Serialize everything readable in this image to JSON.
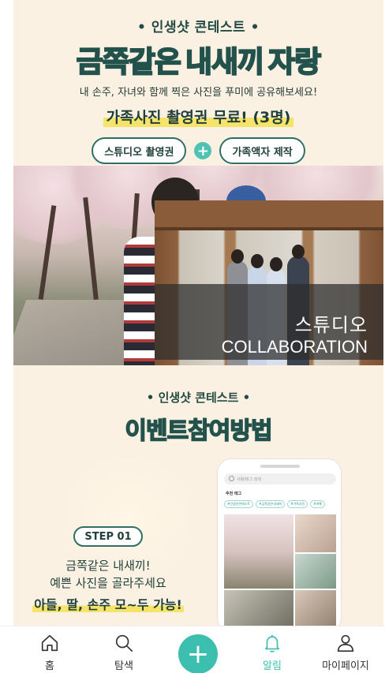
{
  "banner": {
    "pill_title": "• 인생샷 콘테스트 •",
    "title_part1": "금쪽같은",
    "title_part2": "내새끼",
    "title_part3": "자랑",
    "subtitle": "내 손주, 자녀와 함께 찍은 사진을 푸미에 공유해보세요!",
    "highlight": "가족사진 촬영권 무료! (3명)",
    "chip_left": "스튜디오 촬영권",
    "chip_plus": "+",
    "chip_right": "가족액자 제작"
  },
  "studio_card": {
    "line1": "스튜디오",
    "line2": "COLLABORATION"
  },
  "event": {
    "pill_title": "• 인생샷 콘테스트 •",
    "title_part1": "이벤트",
    "title_part2": "참여방법",
    "step_label": "STEP 01",
    "step_line1": "금쪽같은 내새끼!",
    "step_line2": "예쁜 사진을 골라주세요",
    "step_highlight": "아들, 딸, 손주 모~두 가능!",
    "phone": {
      "search_placeholder": "사람/태그 검색",
      "section_label": "추천 태그",
      "tags": [
        "#인생샷콘테스트",
        "#금쪽같은내새끼",
        "#가족사진",
        "#여행"
      ]
    }
  },
  "tabbar": {
    "home": "홈",
    "search": "탐색",
    "add": "+",
    "notifications": "알림",
    "mypage": "마이페이지",
    "active_tab": "notifications",
    "accent_color": "#3cbfae"
  },
  "colors": {
    "banner_bg": "#fbf1e3",
    "title_teal": "#4fc3b3",
    "title_yellow": "#f8e25d",
    "dark_green": "#22524b"
  }
}
